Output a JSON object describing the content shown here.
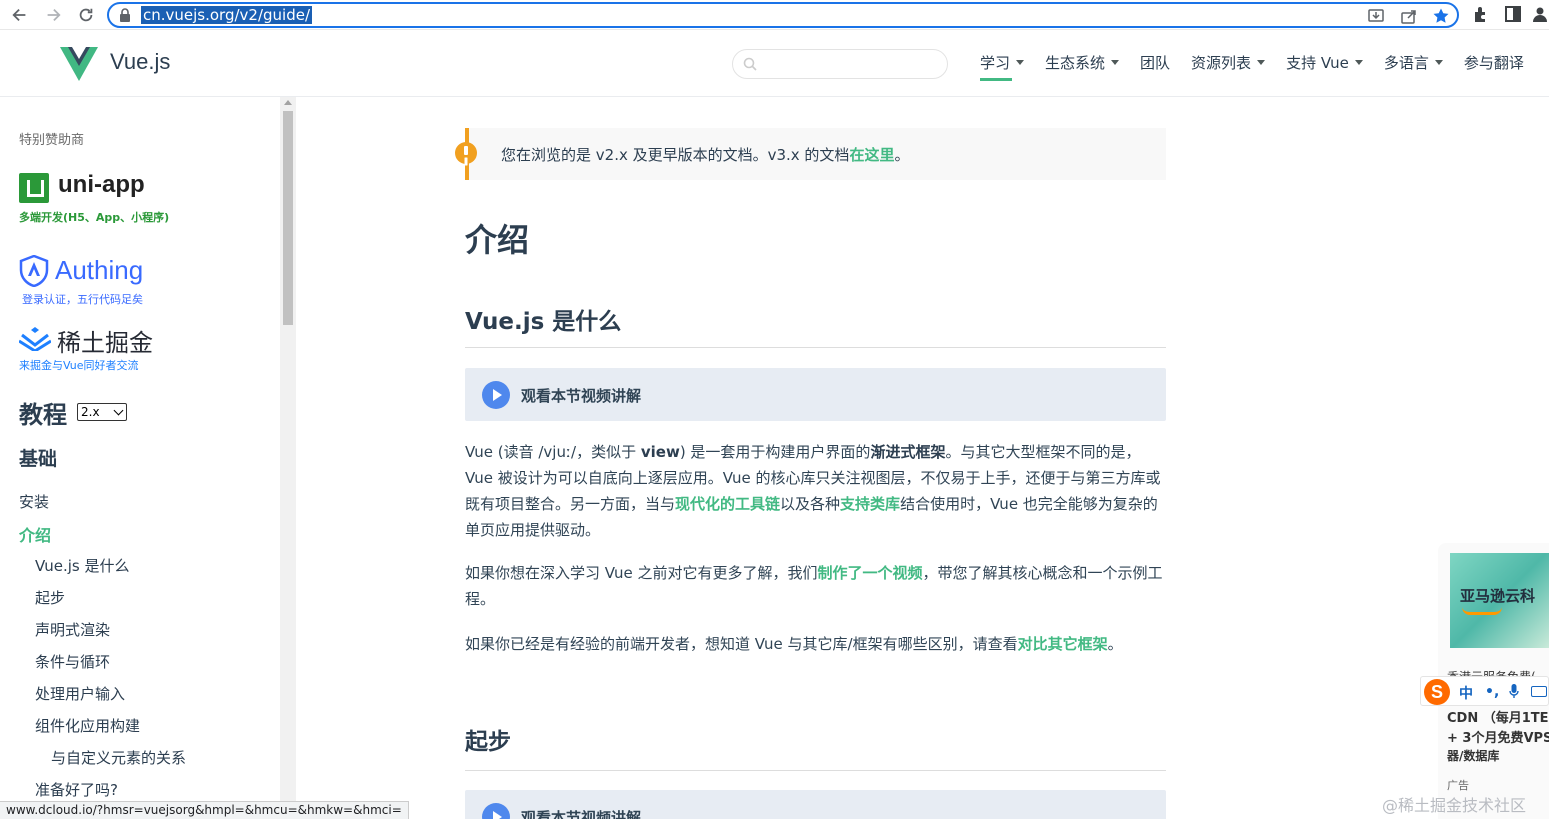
{
  "browser": {
    "url": "cn.vuejs.org/v2/guide/",
    "status_url": "www.dcloud.io/?hmsr=vuejsorg&hmpl=&hmcu=&hmkw=&hmci="
  },
  "header": {
    "logo_text": "Vue.js",
    "nav": [
      {
        "label": "学习",
        "dropdown": true,
        "active": true
      },
      {
        "label": "生态系统",
        "dropdown": true
      },
      {
        "label": "团队",
        "dropdown": false
      },
      {
        "label": "资源列表",
        "dropdown": true
      },
      {
        "label": "支持 Vue",
        "dropdown": true
      },
      {
        "label": "多语言",
        "dropdown": true
      },
      {
        "label": "参与翻译",
        "dropdown": false
      }
    ]
  },
  "sidebar": {
    "sponsor_label": "特别赞助商",
    "sponsors": {
      "uniapp": {
        "name": "uni-app",
        "sub": "多端开发(H5、App、小程序)"
      },
      "authing": {
        "name": "Authing",
        "sub": "登录认证，五行代码足矣"
      },
      "juejin": {
        "name": "稀土掘金",
        "sub": "来掘金与Vue同好者交流"
      }
    },
    "tutorial_title": "教程",
    "version": "2.x",
    "section_title": "基础",
    "links": [
      {
        "label": "安装",
        "level": 0
      },
      {
        "label": "介绍",
        "level": 0,
        "active": true
      },
      {
        "label": "Vue.js 是什么",
        "level": 1
      },
      {
        "label": "起步",
        "level": 1
      },
      {
        "label": "声明式渲染",
        "level": 1
      },
      {
        "label": "条件与循环",
        "level": 1
      },
      {
        "label": "处理用户输入",
        "level": 1
      },
      {
        "label": "组件化应用构建",
        "level": 1
      },
      {
        "label": "与自定义元素的关系",
        "level": 2
      },
      {
        "label": "准备好了吗?",
        "level": 1
      }
    ]
  },
  "main": {
    "tip": {
      "text": "您在浏览的是 v2.x 及更早版本的文档。v3.x 的文档",
      "link": "在这里",
      "end": "。"
    },
    "title": "介绍",
    "section1": "Vue.js 是什么",
    "video_label": "观看本节视频讲解",
    "p1": {
      "a": "Vue (读音 /vjuː/，类似于 ",
      "b": "view",
      "c": ") 是一套用于构建用户界面的",
      "d": "渐进式框架",
      "e": "。与其它大型框架不同的是，Vue 被设计为可以自底向上逐层应用。Vue 的核心库只关注视图层，不仅易于上手，还便于与第三方库或既有项目整合。另一方面，当与",
      "f": "现代化的工具链",
      "g": "以及各种",
      "h": "支持类库",
      "i": "结合使用时，Vue 也完全能够为复杂的单页应用提供驱动。"
    },
    "p2": {
      "a": "如果你想在深入学习 Vue 之前对它有更多了解，我们",
      "b": "制作了一个视频",
      "c": "，带您了解其核心概念和一个示例工程。"
    },
    "p3": {
      "a": "如果你已经是有经验的前端开发者，想知道 Vue 与其它库/框架有哪些区别，请查看",
      "b": "对比其它框架",
      "c": "。"
    },
    "section2": "起步"
  },
  "ad": {
    "title": "亚马逊云科",
    "trunc": "香港云服务免费(",
    "line1": "CDN （每月1TE",
    "line2": "+ 3个月免费VPS",
    "line3": "器/数据库",
    "label": "广告"
  },
  "ime": {
    "s": "S",
    "zh": "中",
    "dot": "•,"
  },
  "watermark": "@稀土掘金技术社区",
  "colors": {
    "accent": "#42b983",
    "warning": "#f1a020",
    "text": "#2c3e50"
  }
}
